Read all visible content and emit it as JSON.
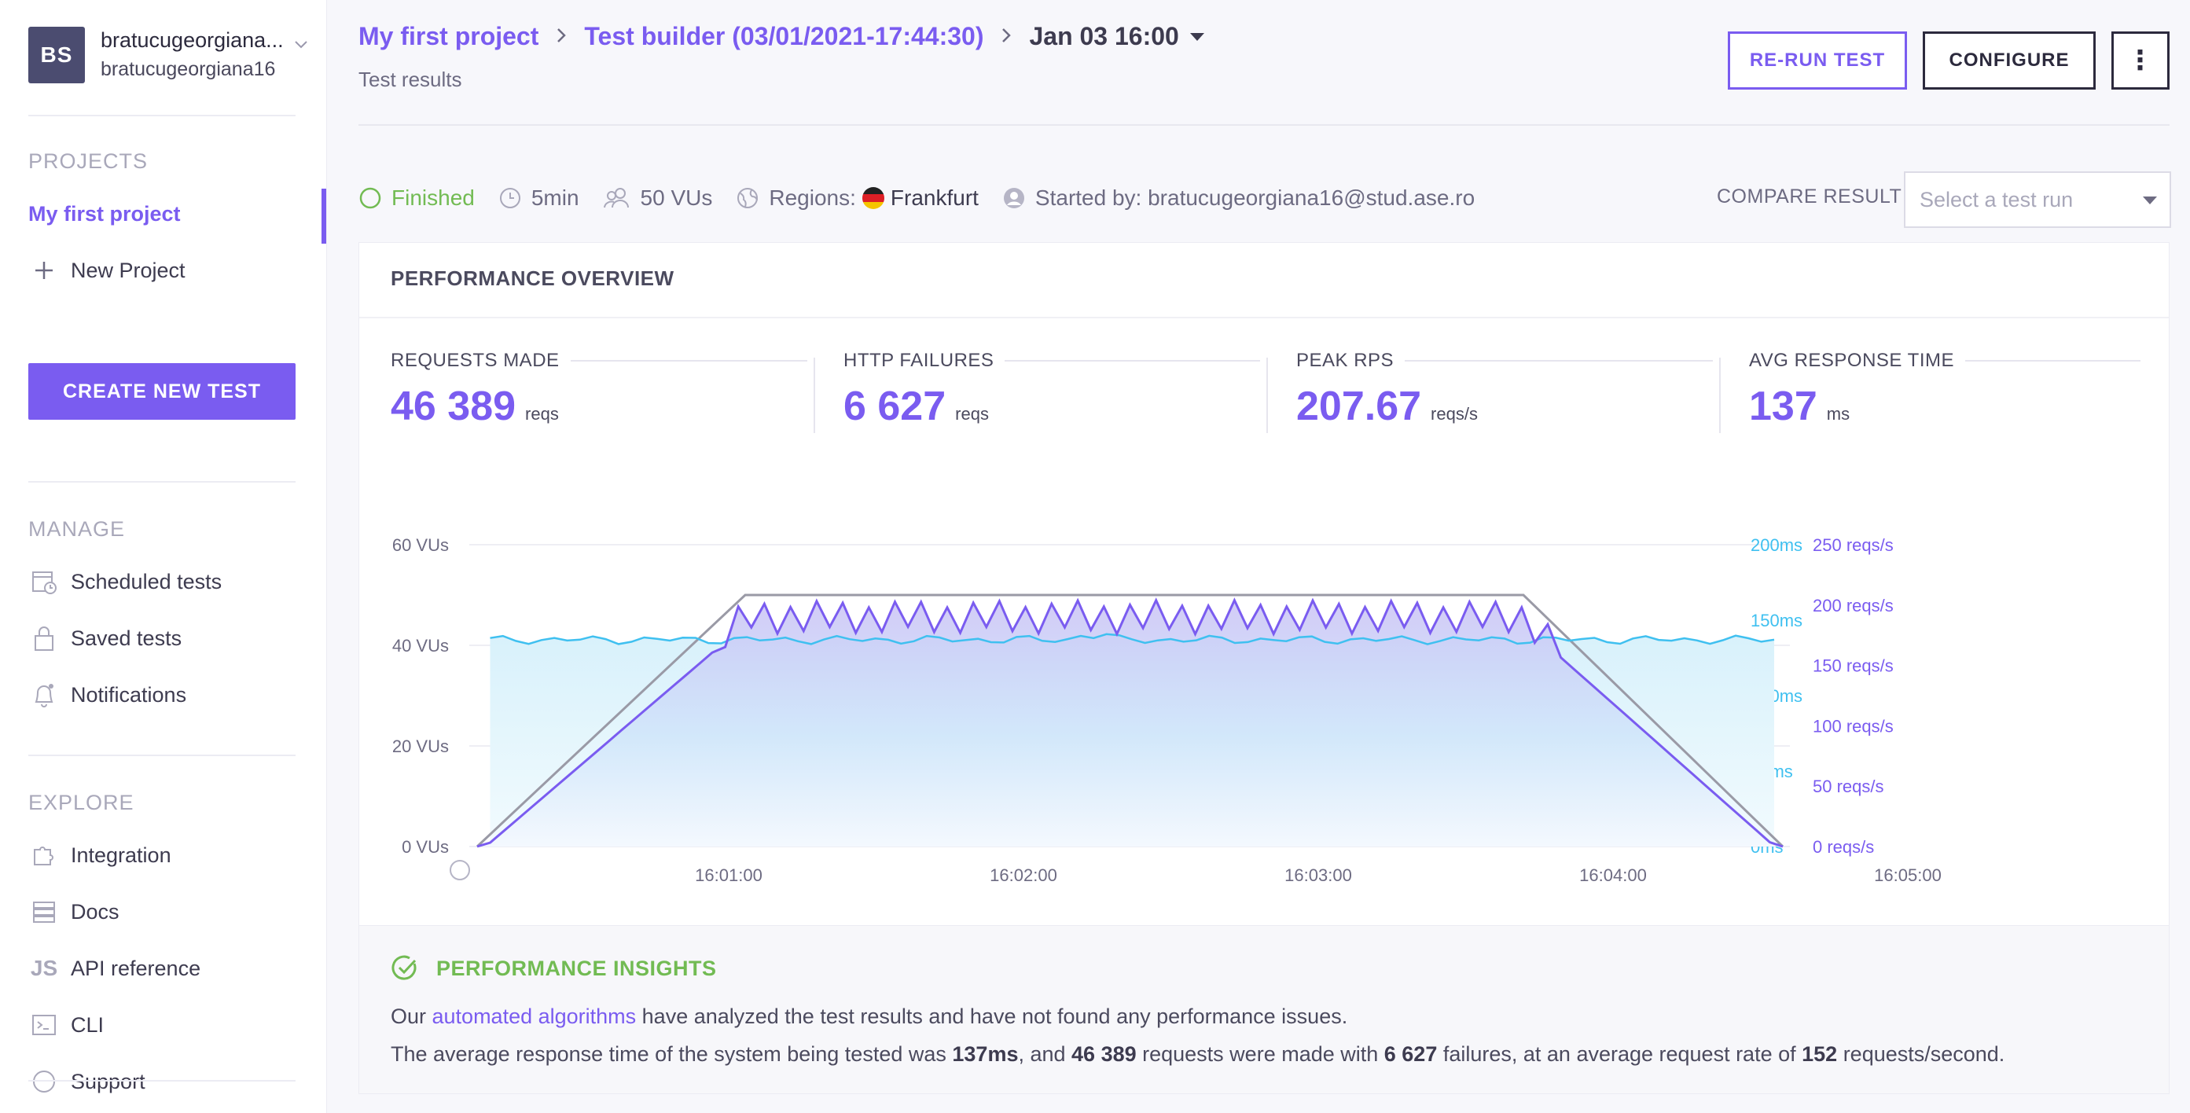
{
  "user": {
    "initials": "BS",
    "name": "bratucugeorgiana...",
    "username": "bratucugeorgiana16"
  },
  "sidebar": {
    "projects_heading": "PROJECTS",
    "projects": [
      {
        "label": "My first project"
      }
    ],
    "new_project": "New Project",
    "create_test": "CREATE NEW TEST",
    "manage_heading": "MANAGE",
    "manage": [
      {
        "label": "Scheduled tests",
        "icon": "calendar-clock-icon"
      },
      {
        "label": "Saved tests",
        "icon": "lock-icon"
      },
      {
        "label": "Notifications",
        "icon": "bell-icon"
      }
    ],
    "explore_heading": "EXPLORE",
    "explore": [
      {
        "label": "Integration",
        "icon": "puzzle-icon"
      },
      {
        "label": "Docs",
        "icon": "docs-icon"
      },
      {
        "label": "API reference",
        "icon": "js-icon"
      },
      {
        "label": "CLI",
        "icon": "terminal-icon"
      },
      {
        "label": "Support",
        "icon": "help-icon"
      }
    ]
  },
  "header": {
    "breadcrumb": [
      "My first project",
      "Test builder (03/01/2021-17:44:30)"
    ],
    "current_run": "Jan 03 16:00",
    "subtitle": "Test results",
    "rerun_label": "RE-RUN TEST",
    "configure_label": "CONFIGURE",
    "more_label": "⋮"
  },
  "status": {
    "state": "Finished",
    "duration": "5min",
    "vus": "50 VUs",
    "regions_label": "Regions:",
    "region": "Frankfurt",
    "started_by": "Started by: bratucugeorgiana16@stud.ase.ro",
    "compare_label": "COMPARE RESULT",
    "compare_placeholder": "Select a test run"
  },
  "overview": {
    "title": "PERFORMANCE OVERVIEW",
    "metrics": [
      {
        "label": "REQUESTS MADE",
        "value": "46 389",
        "unit": "reqs"
      },
      {
        "label": "HTTP FAILURES",
        "value": "6 627",
        "unit": "reqs"
      },
      {
        "label": "PEAK RPS",
        "value": "207.67",
        "unit": "reqs/s"
      },
      {
        "label": "AVG RESPONSE TIME",
        "value": "137",
        "unit": "ms"
      }
    ]
  },
  "colors": {
    "accent": "#7a5cf0",
    "success": "#72bb53",
    "response": "#3fc0f0",
    "vus": "#9a9aa6"
  },
  "chart_data": {
    "type": "line",
    "x_ticks": [
      "16:01:00",
      "16:02:00",
      "16:03:00",
      "16:04:00",
      "16:05:00"
    ],
    "x_range_seconds": [
      0,
      300
    ],
    "y_left": {
      "ticks": [
        "0 VUs",
        "20 VUs",
        "40 VUs",
        "60 VUs"
      ],
      "range": [
        0,
        60
      ]
    },
    "y_right_ms": {
      "ticks": [
        "0ms",
        "50ms",
        "100ms",
        "150ms",
        "200ms"
      ],
      "range": [
        0,
        200
      ]
    },
    "y_right_rps": {
      "ticks": [
        "0 reqs/s",
        "50 reqs/s",
        "100 reqs/s",
        "150 reqs/s",
        "200 reqs/s",
        "250 reqs/s"
      ],
      "range": [
        0,
        250
      ]
    },
    "series": [
      {
        "unit": "VUs",
        "ramp": [
          [
            0,
            0
          ],
          [
            62,
            50
          ],
          [
            242,
            50
          ],
          [
            302,
            0
          ]
        ]
      },
      {
        "unit": "ms",
        "avg": 137
      },
      {
        "unit": "reqs/s",
        "peak": 207.67,
        "avg": 152
      }
    ]
  },
  "insights": {
    "title": "PERFORMANCE INSIGHTS",
    "line1_pre": "Our ",
    "line1_link": "automated algorithms",
    "line1_post": " have analyzed the test results and have not found any performance issues.",
    "line2_a": "The average response time of the system being tested was ",
    "line2_b": "137ms",
    "line2_c": ", and ",
    "line2_d": "46 389",
    "line2_e": " requests were made with ",
    "line2_f": "6 627",
    "line2_g": " failures, at an average request rate of ",
    "line2_h": "152",
    "line2_i": " requests/second."
  }
}
